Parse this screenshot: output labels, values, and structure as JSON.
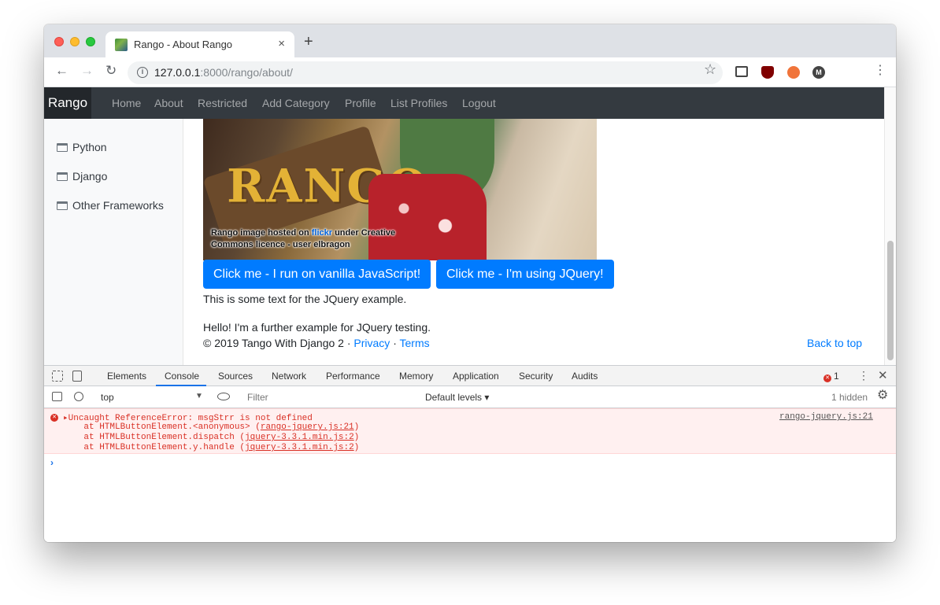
{
  "browser": {
    "tab_title": "Rango - About Rango",
    "tab_close": "×",
    "new_tab": "+",
    "url_host": "127.0.0.1",
    "url_path": ":8000/rango/about/",
    "menu_glyph": "⋮",
    "star_glyph": "☆"
  },
  "nav": {
    "brand": "Rango",
    "links": [
      "Home",
      "About",
      "Restricted",
      "Add Category",
      "Profile",
      "List Profiles",
      "Logout"
    ]
  },
  "sidebar": {
    "items": [
      {
        "label": "Python",
        "icon": "folder-icon"
      },
      {
        "label": "Django",
        "icon": "folder-icon"
      },
      {
        "label": "Other Frameworks",
        "icon": "folder-icon"
      }
    ]
  },
  "content": {
    "image_sign_text": "RANGO",
    "caption_prefix": "Rango image hosted on ",
    "caption_link": "flickr",
    "caption_suffix": " under Creative Commons licence - user elbragon",
    "button_vanilla": "Click me - I run on vanilla JavaScript!",
    "button_jquery": "Click me - I'm using JQuery!",
    "text_jquery": "This is some text for the JQuery example.",
    "text_hello": "Hello! I'm a further example for JQuery testing.",
    "footer_copyright": "© 2019 Tango With Django 2 · ",
    "footer_privacy": "Privacy",
    "footer_sep": " · ",
    "footer_terms": "Terms",
    "back_to_top": "Back to top"
  },
  "devtools": {
    "tabs": [
      "Elements",
      "Console",
      "Sources",
      "Network",
      "Performance",
      "Memory",
      "Application",
      "Security",
      "Audits"
    ],
    "active_tab": "Console",
    "error_count": "1",
    "context": "top",
    "filter_placeholder": "Filter",
    "levels": "Default levels ▾",
    "hidden_count": "1 hidden",
    "error": {
      "message": "▸Uncaught ReferenceError: msgStrr is not defined",
      "stack": [
        {
          "prefix": "    at HTMLButtonElement.<anonymous> (",
          "src": "rango-jquery.js:21",
          "suffix": ")"
        },
        {
          "prefix": "    at HTMLButtonElement.dispatch (",
          "src": "jquery-3.3.1.min.js:2",
          "suffix": ")"
        },
        {
          "prefix": "    at HTMLButtonElement.y.handle (",
          "src": "jquery-3.3.1.min.js:2",
          "suffix": ")"
        }
      ],
      "source": "rango-jquery.js:21"
    },
    "prompt": "›"
  },
  "colors": {
    "navbar": "#343a40",
    "primary": "#007bff",
    "error": "#d93025",
    "error_bg": "#fff0f0"
  }
}
